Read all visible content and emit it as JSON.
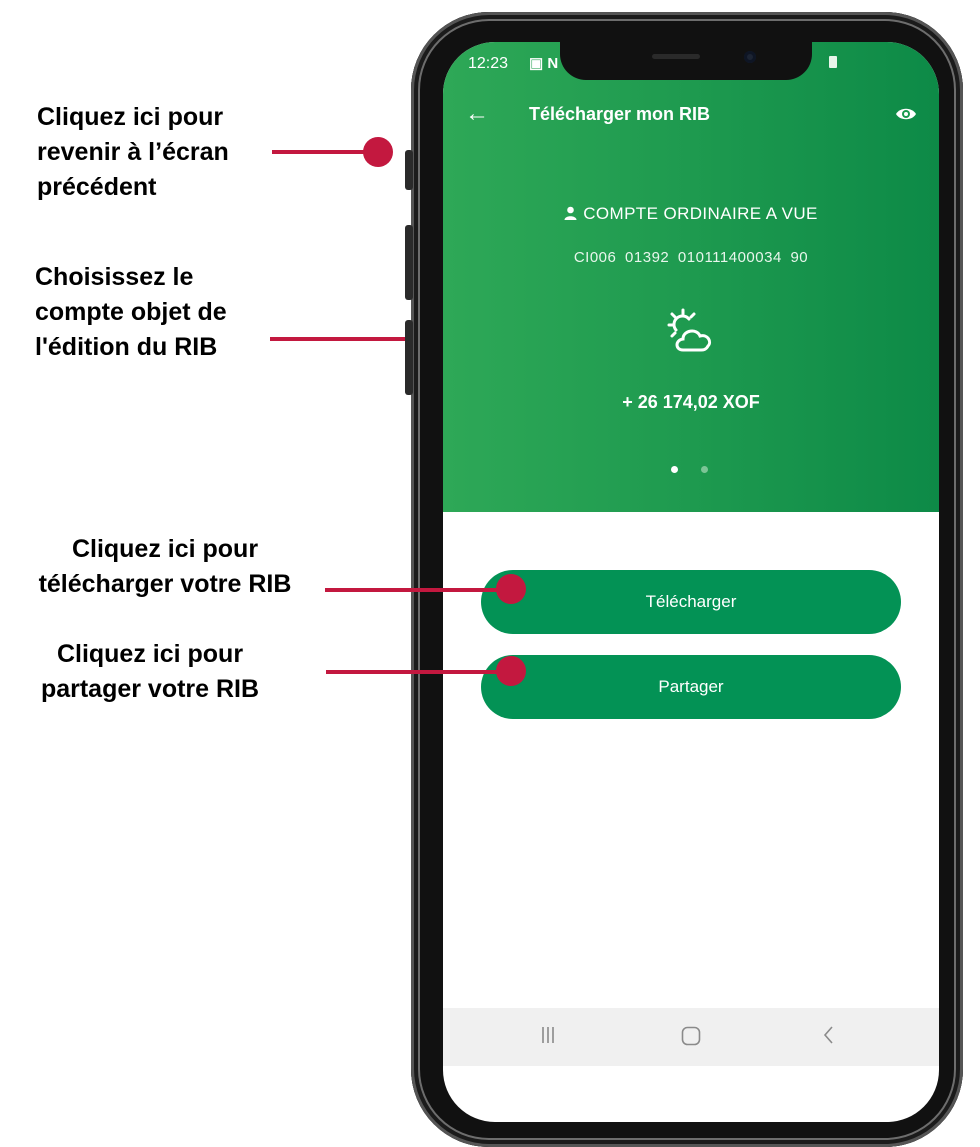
{
  "annotations": {
    "back": [
      "Cliquez ici pour",
      "revenir à l’écran",
      "précédent"
    ],
    "account": [
      "Choisissez le",
      "compte objet de",
      "l'édition du RIB"
    ],
    "download": [
      "Cliquez ici pour",
      "télécharger votre RIB"
    ],
    "share": [
      "Cliquez ici pour",
      "partager votre RIB"
    ],
    "accent_color": "#c3183f"
  },
  "status_bar": {
    "time": "12:23",
    "icons": "▣ N"
  },
  "header": {
    "title": "Télécharger mon RIB",
    "back_icon": "arrow-left-icon",
    "visibility_icon": "eye-icon",
    "background_color": "#1e9a4f"
  },
  "account": {
    "type": "COMPTE ORDINAIRE A VUE",
    "number": "CI006 01392 010111400034 90",
    "weather_icon": "sun-cloud-icon",
    "balance": "+ 26 174,02 XOF",
    "carousel": {
      "pages": 2,
      "active": 1
    }
  },
  "actions": {
    "download_label": "Télécharger",
    "share_label": "Partager",
    "button_color": "#039255"
  },
  "navbar": {
    "recent_icon": "recent-apps-icon",
    "home_icon": "home-icon",
    "back_icon": "nav-back-icon"
  }
}
